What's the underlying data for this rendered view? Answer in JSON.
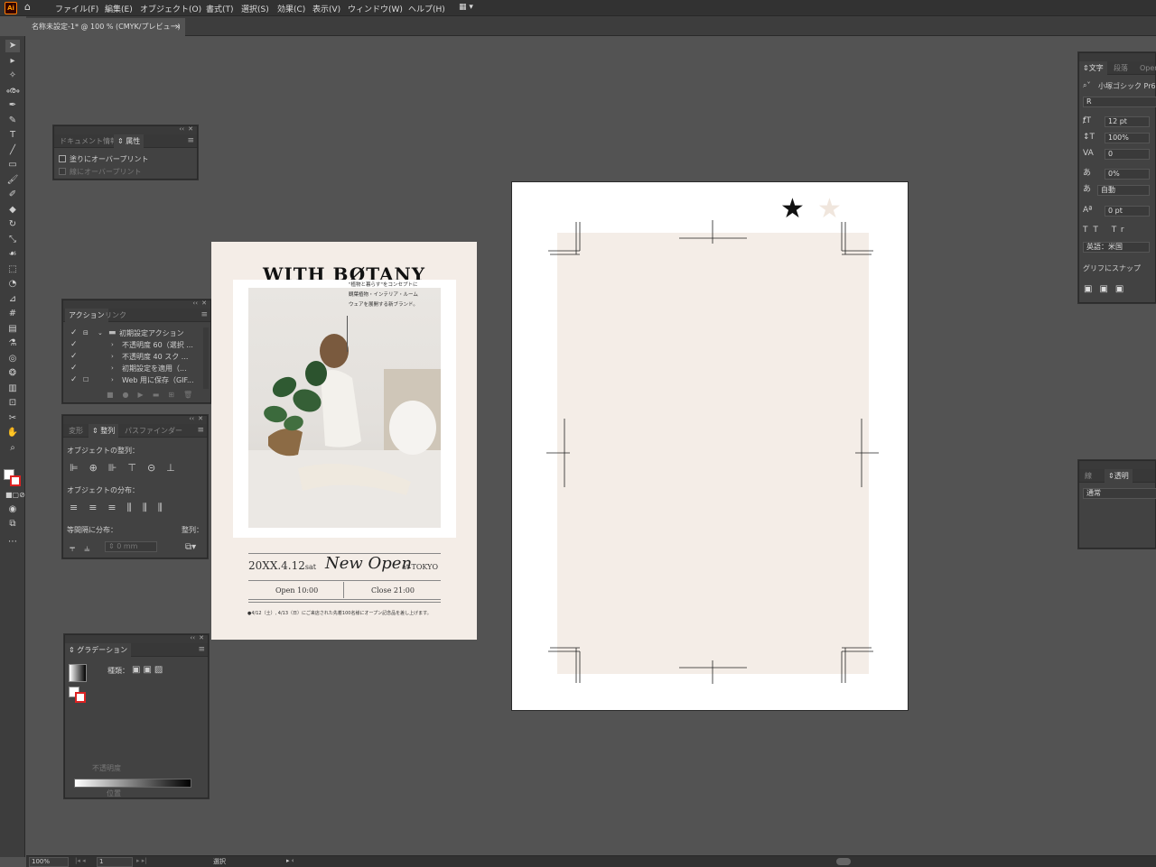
{
  "app": {
    "logo": "Ai",
    "menus": [
      "ファイル(F)",
      "編集(E)",
      "オブジェクト(O)",
      "書式(T)",
      "選択(S)",
      "効果(C)",
      "表示(V)",
      "ウィンドウ(W)",
      "ヘルプ(H)"
    ],
    "document_tab": "名称未設定-1* @ 100 % (CMYK/プレビュー)",
    "close_glyph": "×"
  },
  "attributes_panel": {
    "tab_doc_info": "ドキュメント情報",
    "tab_attributes": "属性",
    "overprint_fill": "塗りにオーバープリント",
    "overprint_stroke": "線にオーバープリント"
  },
  "actions_panel": {
    "tab_actions": "アクション",
    "tab_links": "リンク",
    "items": [
      "初期設定アクション",
      "不透明度 60（選択 ...",
      "不透明度 40 スク ...",
      "初期設定を適用（...",
      "Web 用に保存（GIF..."
    ]
  },
  "align_panel": {
    "tab_transform": "変形",
    "tab_align": "整列",
    "tab_pathfinder": "パスファインダー",
    "align_objects": "オブジェクトの整列：",
    "distribute_objects": "オブジェクトの分布：",
    "distribute_spacing": "等間隔に分布：",
    "align_to": "整列：",
    "spacing_value": "0 mm"
  },
  "gradient_panel": {
    "tab": "グラデーション",
    "type_label": "種類：",
    "opacity_label": "不透明度",
    "position_label": "位置"
  },
  "character_panel": {
    "tab_character": "文字",
    "tab_paragraph": "段落",
    "tab_opentype": "Open",
    "font_family": "小塚ゴシック Pr6",
    "font_style": "R",
    "font_size": "12 pt",
    "vertical_scale": "100%",
    "kerning": "0",
    "tsume": "0%",
    "auto_label": "自動",
    "baseline": "0 pt",
    "language": "英語：米国",
    "glyph_snap": "グリフにスナップ"
  },
  "transparency_panel": {
    "tab_stroke": "線",
    "tab_transparency": "透明",
    "blend_mode": "通常"
  },
  "flyer": {
    "title": "WITH BØTANY",
    "photo_text": [
      "\"植物と暮らす\"をコンセプトに",
      "観葉植物・インテリア・ルーム",
      "ウェアを展開する新ブランド。"
    ],
    "date": "20XX.4.12",
    "weekday": "sat",
    "new_open": "New Open",
    "location": "at TOKYO",
    "open_time": "Open 10:00",
    "close_time": "Close 21:00",
    "note": "●4/12（土）, 4/13（日）にご来店された先着100名様にオープン記念品を差し上げます。"
  },
  "artboard2": {
    "stars": [
      "★",
      "★"
    ],
    "colors": {
      "background": "#f4ede7",
      "star_filled": "#111111",
      "star_light": "#f0e6dd"
    }
  },
  "status_bar": {
    "zoom": "100%",
    "artboard_number": "1",
    "tool_status": "選択"
  },
  "colors": {
    "workspace": "#535353",
    "panel": "#424242",
    "accent": "#ff9a00"
  }
}
